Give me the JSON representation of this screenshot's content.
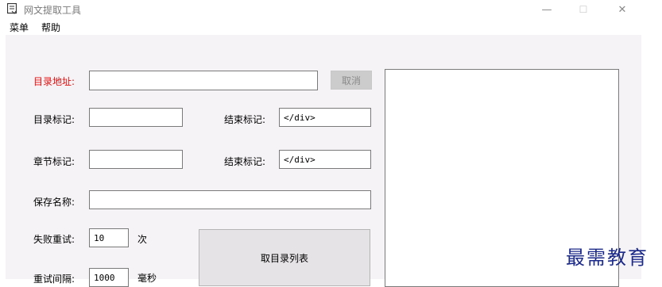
{
  "window": {
    "title": "网文提取工具",
    "controls": {
      "minimize": "—",
      "maximize": "☐",
      "close": "✕"
    }
  },
  "menu": {
    "items": [
      "菜单",
      "帮助"
    ]
  },
  "form": {
    "catalog_url_label": "目录地址:",
    "catalog_url_value": "",
    "cancel_label": "取消",
    "catalog_mark_label": "目录标记:",
    "catalog_mark_value": "",
    "catalog_end_label": "结束标记:",
    "catalog_end_value": "</div>",
    "chapter_mark_label": "章节标记:",
    "chapter_mark_value": "",
    "chapter_end_label": "结束标记:",
    "chapter_end_value": "</div>",
    "save_name_label": "保存名称:",
    "save_name_value": "",
    "retry_label": "失败重试:",
    "retry_value": "10",
    "retry_unit": "次",
    "interval_label": "重试间隔:",
    "interval_value": "1000",
    "interval_unit": "毫秒",
    "fetch_catalog_label": "取目录列表"
  },
  "watermark": {
    "text": "最需教育"
  }
}
